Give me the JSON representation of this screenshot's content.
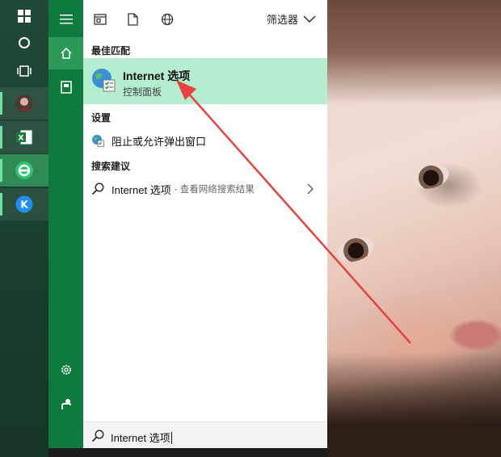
{
  "panel": {
    "filter_label": "筛选器",
    "best_match": {
      "section": "最佳匹配",
      "title": "Internet 选项",
      "subtitle": "控制面板"
    },
    "settings": {
      "section": "设置",
      "item": "阻止或允许弹出窗口"
    },
    "suggestions": {
      "section": "搜索建议",
      "item": "Internet 选项",
      "hint": "- 查看网络搜索结果"
    }
  },
  "search": {
    "query": "Internet 选项"
  },
  "colors": {
    "accent": "#0e7a3c",
    "rail_selected": "#2d9956",
    "highlight": "#b5edd1",
    "arrow": "#e8423f"
  }
}
